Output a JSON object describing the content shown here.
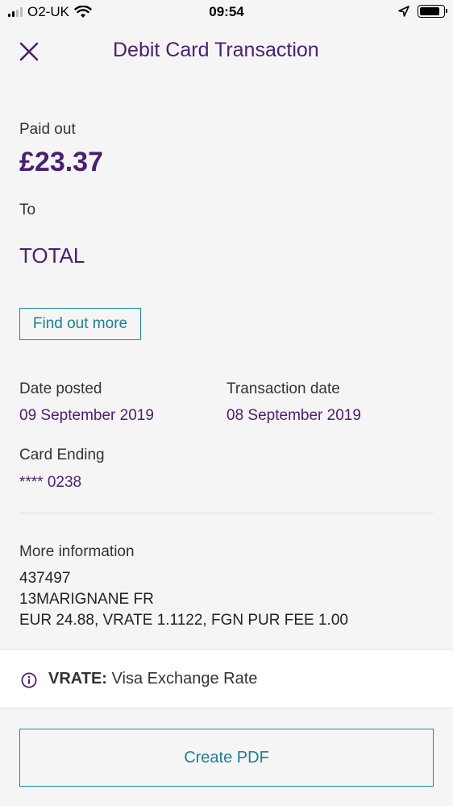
{
  "status_bar": {
    "carrier": "O2-UK",
    "time": "09:54",
    "battery_level": 0.85
  },
  "header": {
    "title": "Debit Card Transaction"
  },
  "transaction": {
    "paid_out_label": "Paid out",
    "amount": "£23.37",
    "to_label": "To",
    "payee": "TOTAL",
    "find_out_more": "Find out more",
    "date_posted_label": "Date posted",
    "date_posted": "09 September 2019",
    "transaction_date_label": "Transaction date",
    "transaction_date": "08 September 2019",
    "card_ending_label": "Card Ending",
    "card_ending": "**** 0238"
  },
  "more_info": {
    "label": "More information",
    "lines": [
      "437497",
      "13MARIGNANE FR",
      "EUR 24.88, VRATE 1.1122, FGN PUR FEE 1.00"
    ]
  },
  "note": {
    "term": "VRATE:",
    "definition": "Visa Exchange Rate"
  },
  "actions": {
    "create_pdf": "Create PDF"
  },
  "colors": {
    "brand_purple": "#4b1f6f",
    "accent_teal": "#1d8a9e"
  }
}
